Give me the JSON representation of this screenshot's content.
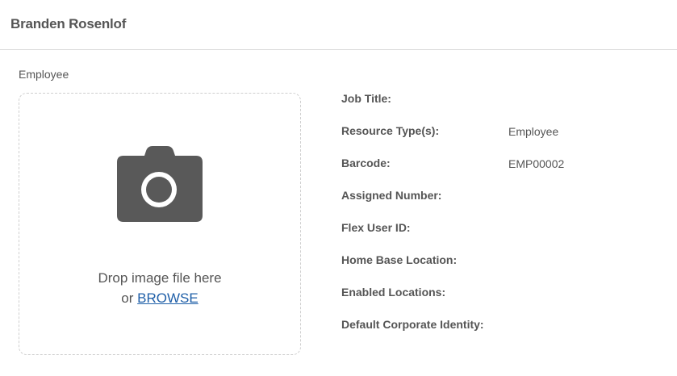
{
  "header": {
    "title": "Branden Rosenlof"
  },
  "record_type": "Employee",
  "dropzone": {
    "prompt": "Drop image file here",
    "or_text": "or",
    "browse_label": "BROWSE",
    "icon": "camera-icon"
  },
  "fields": [
    {
      "label": "Job Title:",
      "value": ""
    },
    {
      "label": "Resource Type(s):",
      "value": "Employee"
    },
    {
      "label": "Barcode:",
      "value": "EMP00002"
    },
    {
      "label": "Assigned Number:",
      "value": ""
    },
    {
      "label": "Flex User ID:",
      "value": ""
    },
    {
      "label": "Home Base Location:",
      "value": ""
    },
    {
      "label": "Enabled Locations:",
      "value": ""
    },
    {
      "label": "Default Corporate Identity:",
      "value": ""
    }
  ],
  "colors": {
    "text": "#555555",
    "link": "#1f5fa8",
    "icon": "#595959",
    "border": "#dcdcdc"
  }
}
